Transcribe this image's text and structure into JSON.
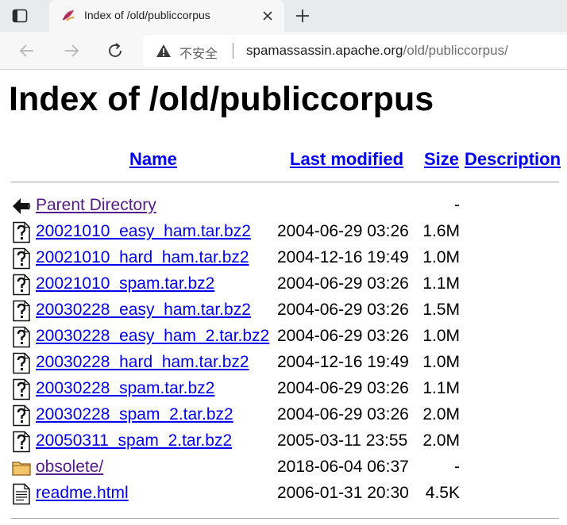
{
  "browser": {
    "tab_title": "Index of /old/publiccorpus",
    "insecure_label": "不安全",
    "url_host": "spamassassin.apache.org",
    "url_path": "/old/publiccorpus/"
  },
  "page": {
    "title": "Index of /old/publiccorpus",
    "columns": {
      "name": "Name",
      "last_modified": "Last modified",
      "size": "Size",
      "description": "Description"
    },
    "entries": [
      {
        "name": "Parent Directory",
        "date": "",
        "size": "-",
        "icon": "back-icon",
        "visited": true
      },
      {
        "name": "20021010_easy_ham.tar.bz2",
        "date": "2004-06-29 03:26",
        "size": "1.6M",
        "icon": "unknown-file-icon",
        "visited": false
      },
      {
        "name": "20021010_hard_ham.tar.bz2",
        "date": "2004-12-16 19:49",
        "size": "1.0M",
        "icon": "unknown-file-icon",
        "visited": false
      },
      {
        "name": "20021010_spam.tar.bz2",
        "date": "2004-06-29 03:26",
        "size": "1.1M",
        "icon": "unknown-file-icon",
        "visited": false
      },
      {
        "name": "20030228_easy_ham.tar.bz2",
        "date": "2004-06-29 03:26",
        "size": "1.5M",
        "icon": "unknown-file-icon",
        "visited": false
      },
      {
        "name": "20030228_easy_ham_2.tar.bz2",
        "date": "2004-06-29 03:26",
        "size": "1.0M",
        "icon": "unknown-file-icon",
        "visited": false
      },
      {
        "name": "20030228_hard_ham.tar.bz2",
        "date": "2004-12-16 19:49",
        "size": "1.0M",
        "icon": "unknown-file-icon",
        "visited": false
      },
      {
        "name": "20030228_spam.tar.bz2",
        "date": "2004-06-29 03:26",
        "size": "1.1M",
        "icon": "unknown-file-icon",
        "visited": false
      },
      {
        "name": "20030228_spam_2.tar.bz2",
        "date": "2004-06-29 03:26",
        "size": "2.0M",
        "icon": "unknown-file-icon",
        "visited": false
      },
      {
        "name": "20050311_spam_2.tar.bz2",
        "date": "2005-03-11 23:55",
        "size": "2.0M",
        "icon": "unknown-file-icon",
        "visited": false
      },
      {
        "name": "obsolete/",
        "date": "2018-06-04 06:37",
        "size": "-",
        "icon": "folder-icon",
        "visited": true
      },
      {
        "name": "readme.html",
        "date": "2006-01-31 20:30",
        "size": "4.5K",
        "icon": "text-file-icon",
        "visited": false
      }
    ]
  },
  "colors": {
    "link": "#0000ee",
    "visited_link": "#551a8b",
    "chrome_bg": "#e9eaeb",
    "toolbar_bg": "#f7f7f7"
  }
}
